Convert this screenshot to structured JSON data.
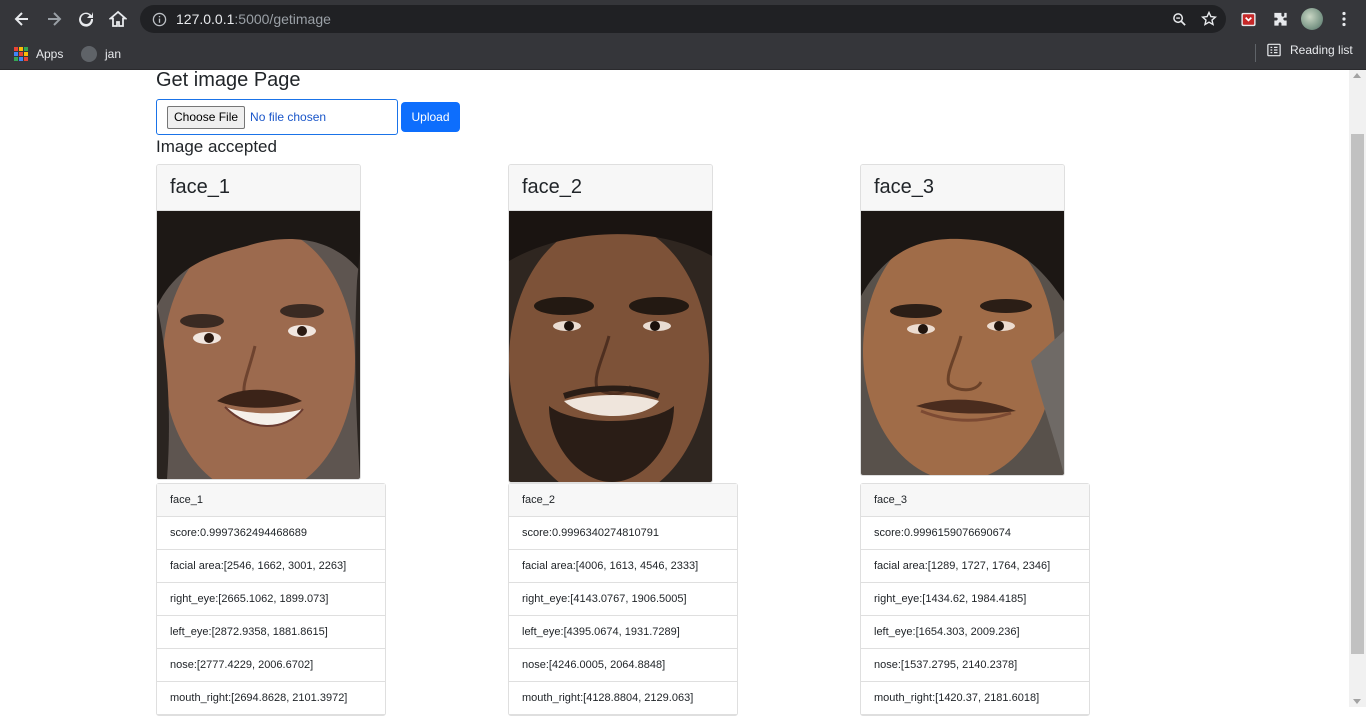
{
  "browser": {
    "url_host": "127.0.0.1",
    "url_path": ":5000/getimage",
    "bookmarks": [
      {
        "label": "Apps"
      },
      {
        "label": "jan"
      }
    ],
    "reading_list": "Reading list"
  },
  "page": {
    "title": "Get image Page",
    "choose_file": "Choose File",
    "no_file": "No file chosen",
    "upload": "Upload",
    "status": "Image accepted"
  },
  "faces": [
    {
      "name": "face_1",
      "score": "score:0.9997362494468689",
      "facial_area": "facial area:[2546, 1662, 3001, 2263]",
      "right_eye": "right_eye:[2665.1062, 1899.073]",
      "left_eye": "left_eye:[2872.9358, 1881.8615]",
      "nose": "nose:[2777.4229, 2006.6702]",
      "mouth_right": "mouth_right:[2694.8628, 2101.3972]"
    },
    {
      "name": "face_2",
      "score": "score:0.9996340274810791",
      "facial_area": "facial area:[4006, 1613, 4546, 2333]",
      "right_eye": "right_eye:[4143.0767, 1906.5005]",
      "left_eye": "left_eye:[4395.0674, 1931.7289]",
      "nose": "nose:[4246.0005, 2064.8848]",
      "mouth_right": "mouth_right:[4128.8804, 2129.063]"
    },
    {
      "name": "face_3",
      "score": "score:0.9996159076690674",
      "facial_area": "facial area:[1289, 1727, 1764, 2346]",
      "right_eye": "right_eye:[1434.62, 1984.4185]",
      "left_eye": "left_eye:[1654.303, 2009.236]",
      "nose": "nose:[1537.2795, 2140.2378]",
      "mouth_right": "mouth_right:[1420.37, 2181.6018]"
    }
  ]
}
